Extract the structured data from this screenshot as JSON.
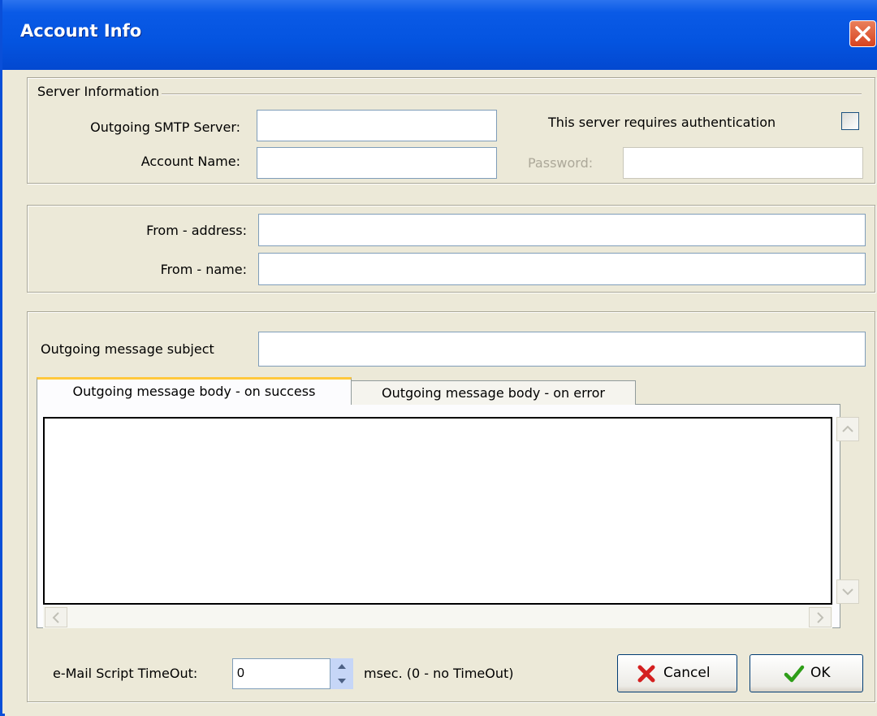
{
  "window": {
    "title": "Account Info"
  },
  "server_info": {
    "group_title": "Server Information",
    "smtp_label": "Outgoing SMTP Server:",
    "smtp_value": "",
    "account_label": "Account Name:",
    "account_value": "",
    "auth_label": "This server requires authentication",
    "auth_checked": false,
    "password_label": "Password:",
    "password_value": ""
  },
  "from": {
    "address_label": "From - address:",
    "address_value": "",
    "name_label": "From - name:",
    "name_value": ""
  },
  "message": {
    "subject_label": "Outgoing message subject",
    "subject_value": "",
    "tabs": [
      {
        "label": "Outgoing message body - on success",
        "active": true
      },
      {
        "label": "Outgoing message body - on error",
        "active": false
      }
    ],
    "body_value": ""
  },
  "footer": {
    "timeout_label": "e-Mail Script TimeOut:",
    "timeout_value": "0",
    "timeout_unit": "msec. (0 - no TimeOut)",
    "cancel_label": "Cancel",
    "ok_label": "OK"
  },
  "icons": {
    "close": "close-icon",
    "cancel": "red-x-icon",
    "ok": "green-check-icon",
    "spin_up": "arrow-up-icon",
    "spin_down": "arrow-down-icon"
  }
}
